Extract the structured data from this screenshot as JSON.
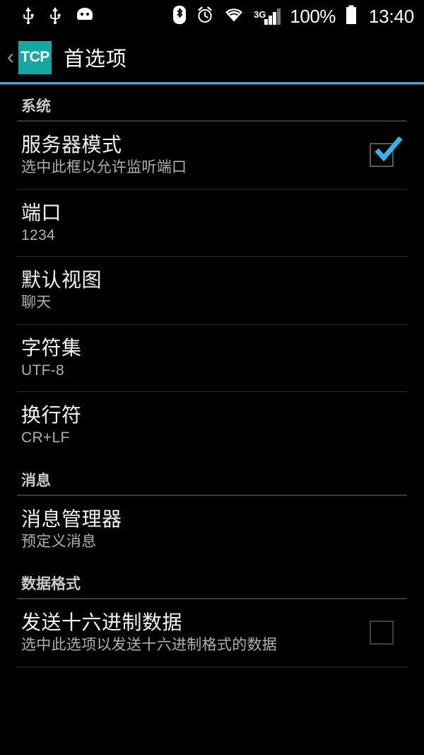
{
  "status_bar": {
    "left_icons": [
      "usb-icon",
      "usb-icon",
      "android-debug-icon"
    ],
    "right_icons": [
      "bluetooth-icon",
      "alarm-icon",
      "wifi-icon",
      "signal-icon"
    ],
    "network_type": "3G",
    "battery_percent": "100%",
    "time": "13:40"
  },
  "action_bar": {
    "back_label": "‹",
    "app_badge": "TCP",
    "title": "首选项",
    "accent_color": "#4ea6cf",
    "badge_color": "#14a8a0"
  },
  "sections": [
    {
      "header": "系统",
      "items": [
        {
          "title": "服务器模式",
          "summary": "选中此框以允许监听端口",
          "widget": "checkbox",
          "checked": true,
          "name": "server-mode"
        },
        {
          "title": "端口",
          "summary": "1234",
          "widget": "none",
          "checked": false,
          "name": "port"
        },
        {
          "title": "默认视图",
          "summary": "聊天",
          "widget": "none",
          "checked": false,
          "name": "default-view"
        },
        {
          "title": "字符集",
          "summary": "UTF-8",
          "widget": "none",
          "checked": false,
          "name": "charset"
        },
        {
          "title": "换行符",
          "summary": "CR+LF",
          "widget": "none",
          "checked": false,
          "name": "line-break"
        }
      ]
    },
    {
      "header": "消息",
      "items": [
        {
          "title": "消息管理器",
          "summary": "预定义消息",
          "widget": "none",
          "checked": false,
          "name": "message-manager"
        }
      ]
    },
    {
      "header": "数据格式",
      "items": [
        {
          "title": "发送十六进制数据",
          "summary": "选中此选项以发送十六进制格式的数据",
          "widget": "checkbox",
          "checked": false,
          "name": "send-hex-data"
        }
      ]
    }
  ]
}
